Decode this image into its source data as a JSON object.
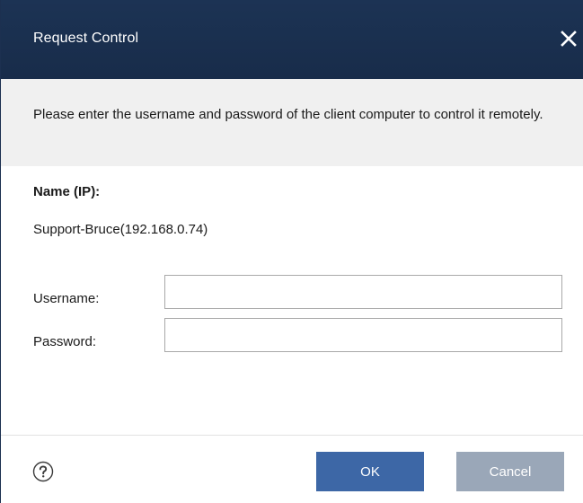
{
  "dialog": {
    "title": "Request Control",
    "close_icon": "close-icon"
  },
  "info": {
    "message": "Please enter the username and password of the client computer to control it remotely."
  },
  "target": {
    "name_label": "Name (IP):",
    "name_value": "Support-Bruce(192.168.0.74)"
  },
  "form": {
    "username_label": "Username:",
    "username_value": "",
    "password_label": "Password:",
    "password_value": ""
  },
  "footer": {
    "help_icon": "help-icon",
    "ok_label": "OK",
    "cancel_label": "Cancel"
  },
  "colors": {
    "title_bar": "#1c3354",
    "ok_button": "#3d67a6",
    "cancel_button": "#9aa7b8",
    "info_band": "#f0f0f0"
  }
}
